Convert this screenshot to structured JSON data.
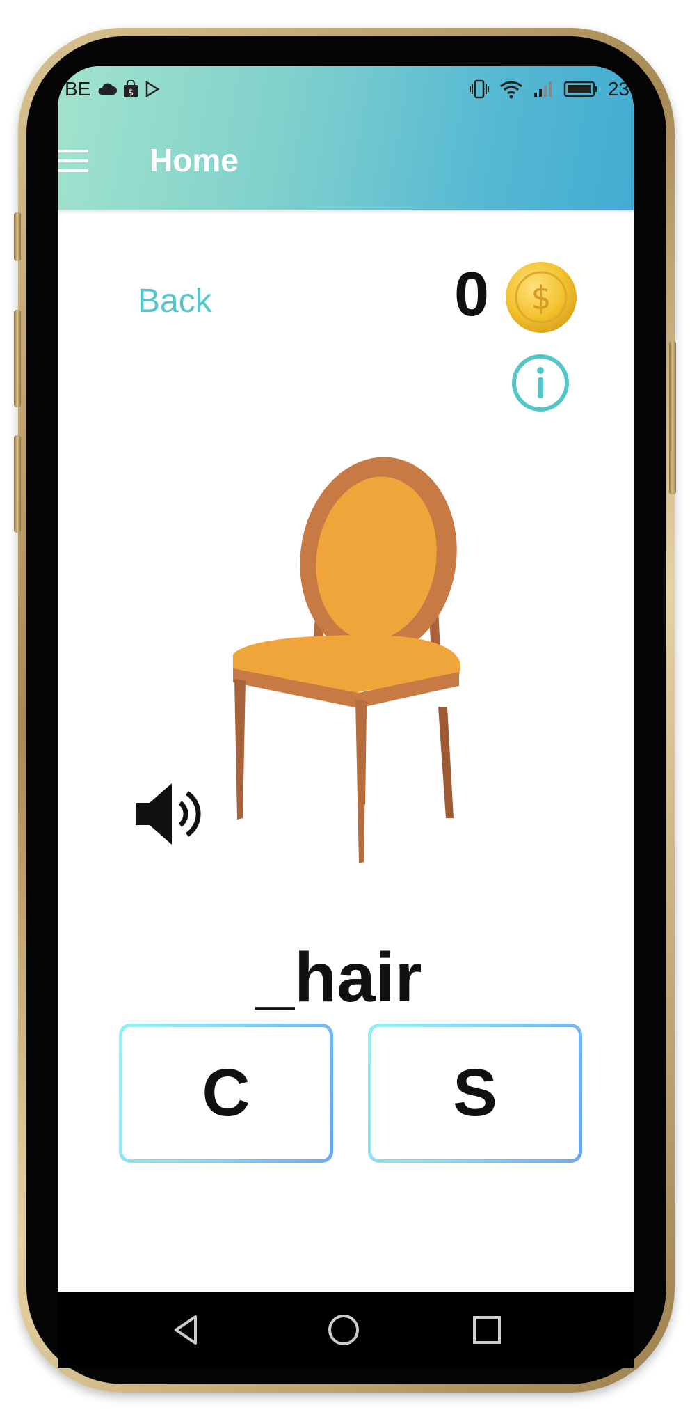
{
  "status_bar": {
    "left_text": "BE",
    "time": "23"
  },
  "appbar": {
    "title": "Home"
  },
  "game": {
    "back_label": "Back",
    "coins": "0",
    "word": "_hair",
    "choices": [
      "C",
      "S"
    ]
  },
  "icons": {
    "menu": "menu-icon",
    "coin": "dollar-coin-icon",
    "info": "info-icon",
    "speaker": "speaker-icon",
    "picture": "chair-picture",
    "nav_back": "triangle-back-icon",
    "nav_home": "circle-home-icon",
    "nav_recent": "square-recents-icon"
  },
  "colors": {
    "accent": "#54c6c9",
    "appbar_start": "#a2e3cd",
    "appbar_end": "#43acd2",
    "coin": "#f2c230",
    "choice_border": "#86cdf2"
  }
}
